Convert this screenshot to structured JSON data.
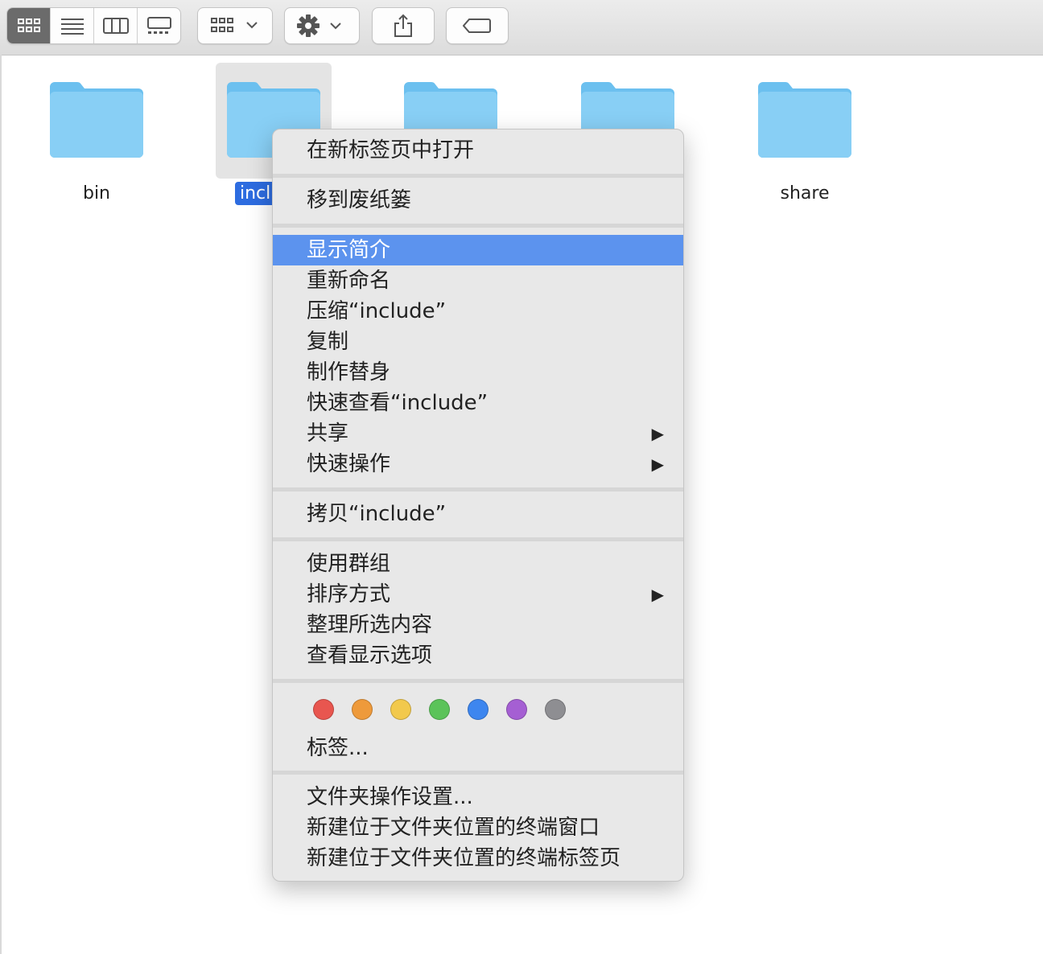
{
  "toolbar": {
    "view_modes": [
      "icon-view",
      "list-view",
      "column-view",
      "gallery-view"
    ],
    "active_view": "icon-view"
  },
  "folders": [
    {
      "name": "bin",
      "selected": false
    },
    {
      "name": "incl",
      "selected": true
    },
    {
      "name": "",
      "selected": false
    },
    {
      "name": "",
      "selected": false
    },
    {
      "name": "share",
      "selected": false
    }
  ],
  "context_menu": {
    "open_new_tab": "在新标签页中打开",
    "move_to_trash": "移到废纸篓",
    "get_info": "显示简介",
    "rename": "重新命名",
    "compress": "压缩“include”",
    "duplicate": "复制",
    "make_alias": "制作替身",
    "quick_look": "快速查看“include”",
    "share": "共享",
    "quick_actions": "快速操作",
    "copy": "拷贝“include”",
    "use_groups": "使用群组",
    "sort_by": "排序方式",
    "clean_up_selection": "整理所选内容",
    "show_view_options": "查看显示选项",
    "tags": "标签...",
    "folder_actions_setup": "文件夹操作设置...",
    "new_terminal_at_folder": "新建位于文件夹位置的终端窗口",
    "new_terminal_tab_at_folder": "新建位于文件夹位置的终端标签页",
    "submenu_arrow": "▶",
    "highlighted_item": "get_info"
  },
  "tag_colors": [
    "#e8564f",
    "#ee9a3b",
    "#f2c94c",
    "#5bc359",
    "#3d86ef",
    "#a55fd3",
    "#8e8e92"
  ]
}
